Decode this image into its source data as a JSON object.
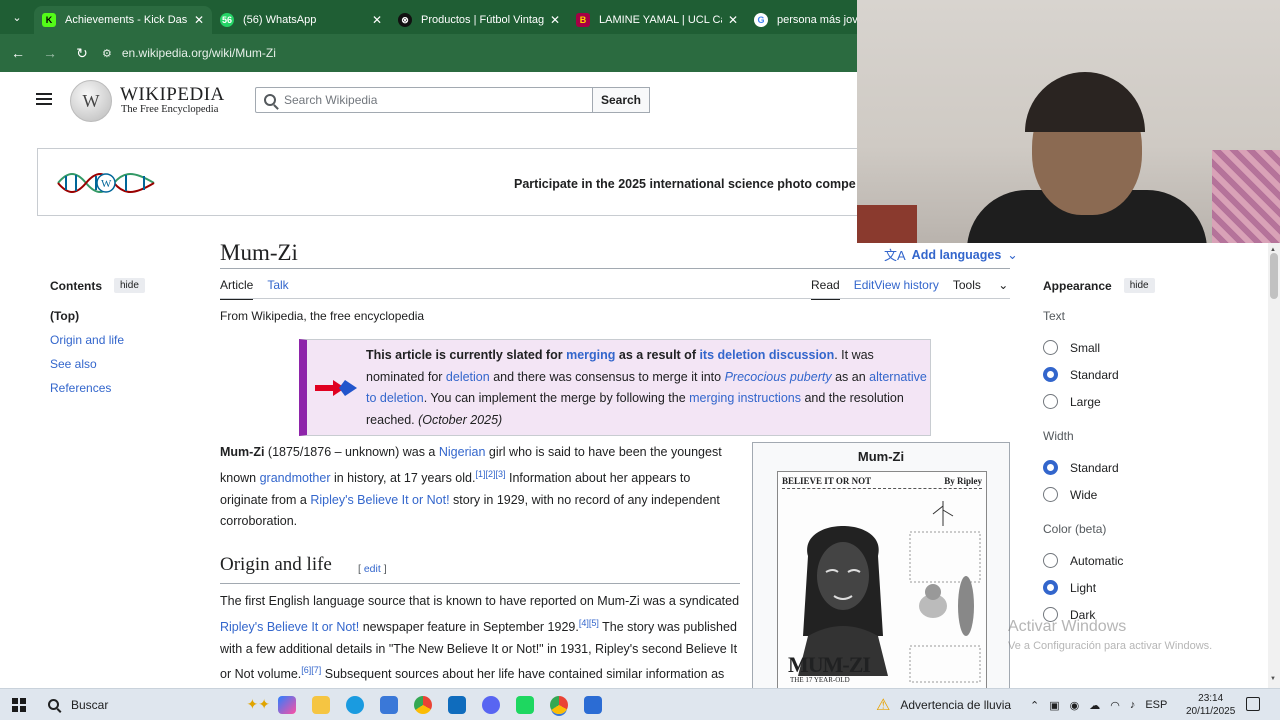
{
  "browser": {
    "tabs": [
      {
        "title": "Achievements - Kick Dashb",
        "fav": "K",
        "fav_color": "#53fc18"
      },
      {
        "title": "(56) WhatsApp",
        "fav": "56",
        "fav_color": "#25d366"
      },
      {
        "title": "Productos | Fútbol Vintage",
        "fav": "⊗",
        "fav_color": "#111111"
      },
      {
        "title": "LAMINE YAMAL | UCL Cam",
        "fav": "B",
        "fav_color": "#a50044"
      },
      {
        "title": "persona más joven e",
        "fav": "G",
        "fav_color": "#ffffff"
      }
    ],
    "url": "en.wikipedia.org/wiki/Mum-Zi"
  },
  "header": {
    "wordmark": "WIKIPEDIA",
    "tagline": "The Free Encyclopedia",
    "search_placeholder": "Search Wikipedia",
    "search_button": "Search"
  },
  "banner": {
    "text": "Participate in the 2025 international science photo compe"
  },
  "page": {
    "title": "Mum-Zi",
    "add_languages": "Add languages",
    "tabs_left": [
      "Article",
      "Talk"
    ],
    "tabs_right": [
      "Read",
      "Edit",
      "View history",
      "Tools"
    ],
    "from": "From Wikipedia, the free encyclopedia"
  },
  "toc": {
    "heading": "Contents",
    "hide": "hide",
    "items": [
      "(Top)",
      "Origin and life",
      "See also",
      "References"
    ]
  },
  "notice": {
    "b1": "This article is currently slated for ",
    "l1": "merging",
    "b2": " as a result of ",
    "l2": "its deletion discussion",
    "t1": ". It was nominated for ",
    "l3": "deletion",
    "t2": " and there was consensus to merge it into ",
    "l4": "Precocious puberty",
    "t3": " as an ",
    "l5": "alternative to deletion",
    "t4": ". You can implement the merge by following the ",
    "l6": "merging instructions",
    "t5": " and the resolution reached. ",
    "date": "(October 2025)"
  },
  "intro": {
    "bold": "Mum-Zi",
    "t1": " (1875/1876 – unknown) was a ",
    "l1": "Nigerian",
    "t2": " girl who is said to have been the youngest known ",
    "l2": "grandmother",
    "t3": " in history, at 17 years old.",
    "refs": "[1][2][3]",
    "t4": " Information about her appears to originate from a ",
    "l3": "Ripley's Believe It or Not!",
    "t5": " story in 1929, with no record of any independent corroboration."
  },
  "section": {
    "title": "Origin and life",
    "edit_open": "[ ",
    "edit": "edit",
    "edit_close": " ]",
    "t1": "The first English language source that is known to have reported on Mum-Zi was a syndicated ",
    "l1": "Ripley's Believe It or Not!",
    "t2": " newspaper feature in September 1929.",
    "r1": "[4][5]",
    "t3": " The story was published with a few additional details in \"The New Believe It or Not!\" in 1931, Ripley's second Believe It or Not volume.",
    "r2": "[6][7]",
    "t4": " Subsequent sources about her life have contained similar information as Ripley's accounts."
  },
  "infobox": {
    "title": "Mum-Zi",
    "image_header_left": "BELIEVE IT OR NOT",
    "image_header_right": "By Ripley",
    "image_caption": "MUM-ZI",
    "image_sub": "THE 17 YEAR-OLD"
  },
  "appearance": {
    "heading": "Appearance",
    "hide": "hide",
    "text_label": "Text",
    "text_options": [
      "Small",
      "Standard",
      "Large"
    ],
    "text_selected": "Standard",
    "width_label": "Width",
    "width_options": [
      "Standard",
      "Wide"
    ],
    "width_selected": "Standard",
    "color_label": "Color (beta)",
    "color_options": [
      "Automatic",
      "Light",
      "Dark"
    ],
    "color_selected": "Light"
  },
  "watermark": {
    "title": "Activar Windows",
    "sub": "Ve a Configuración para activar Windows."
  },
  "taskbar": {
    "search": "Buscar",
    "weather": "Advertencia de lluvia",
    "lang": "ESP",
    "time": "23:14",
    "date": "20/11/2025"
  },
  "colors": {
    "link": "#3366cc",
    "chrome": "#1f5e34",
    "notice_bar": "#8e24aa"
  }
}
